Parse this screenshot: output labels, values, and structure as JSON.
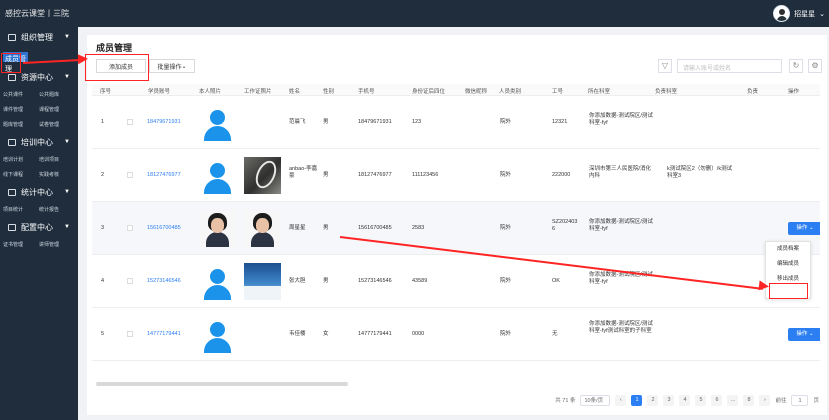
{
  "app": {
    "brand": "感控云课堂丨三院",
    "user": "招星星"
  },
  "sidebar": {
    "groups": [
      "组织管理",
      "资源中心",
      "培训中心",
      "统计中心",
      "配置中心"
    ],
    "active": "成员管理",
    "rows": [
      [
        "公共课件",
        "公共题库"
      ],
      [
        "课件管理",
        "课程管理"
      ],
      [
        "题库管理",
        "试卷管理"
      ],
      [
        "培训计划",
        "培训项目"
      ],
      [
        "线下课程",
        "实践考核"
      ],
      [
        "项目统计",
        "统计报告"
      ],
      [
        "证书管理",
        "讲师管理"
      ]
    ]
  },
  "page": {
    "title": "成员管理",
    "add_label": "添加成员",
    "batch_label": "批量操作",
    "search_placeholder": "请输入账号或姓名"
  },
  "table": {
    "headers": [
      "序号",
      "学员账号",
      "本人照片",
      "工作证照片",
      "姓名",
      "性别",
      "手机号",
      "身份证后四位",
      "微信昵称",
      "人员类别",
      "工号",
      "所在科室",
      "负责科室",
      "负责",
      "操作"
    ],
    "rows": [
      {
        "no": "1",
        "account": "18479671931",
        "name": "范晨飞",
        "gender": "男",
        "phone": "18479671931",
        "id4": "123",
        "category": "院外",
        "job": "12321",
        "dept": "你添加数据-测试院区/测试科室-fyf",
        "charge": ""
      },
      {
        "no": "2",
        "account": "18127476977",
        "name": "anbao-李嘉豪",
        "gender": "男",
        "phone": "18127476977",
        "id4": "111123456",
        "category": "院外",
        "job": "222000",
        "dept": "深圳市第三人民医院/消化内科",
        "charge": "k测试院区2（勿删）/k测试科室3"
      },
      {
        "no": "3",
        "account": "15616700485",
        "name": "周星星",
        "gender": "男",
        "phone": "15616700485",
        "id4": "2583",
        "category": "院外",
        "job": "SZ2024036",
        "dept": "你添加数据-测试院区/测试科室-fyf",
        "charge": ""
      },
      {
        "no": "4",
        "account": "15273146546",
        "name": "张大胆",
        "gender": "男",
        "phone": "15273146546",
        "id4": "43589",
        "category": "院外",
        "job": "OK",
        "dept": "你添加数据-测试院区/测试科室-fyf",
        "charge": ""
      },
      {
        "no": "5",
        "account": "14777179441",
        "name": "韦佳楼",
        "gender": "女",
        "phone": "14777179441",
        "id4": "0000",
        "category": "院外",
        "job": "无",
        "dept": "你添加数据-测试院区/测试科室-fyf测试科室的子科室",
        "charge": ""
      }
    ],
    "operation_label": "操作"
  },
  "dropdown": [
    "成员档案",
    "编辑成员",
    "移出成员"
  ],
  "pagination": {
    "total": "共 71 条",
    "size": "10条/页",
    "pages": [
      "1",
      "2",
      "3",
      "4",
      "5",
      "6",
      "...",
      "8"
    ],
    "goto_label": "前往",
    "goto_value": "1",
    "page_unit": "页"
  },
  "colors": {
    "accent": "#2b7ff2",
    "sidebar": "#1f2d3d",
    "annotation": "#ff2424"
  }
}
